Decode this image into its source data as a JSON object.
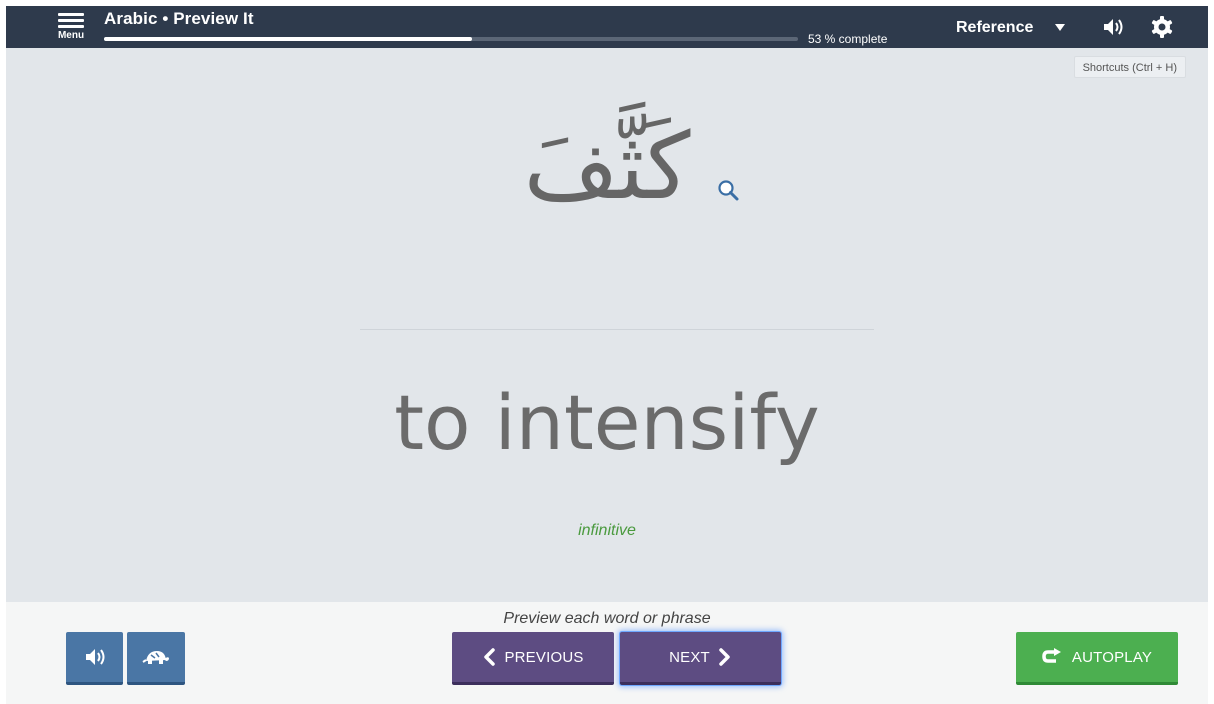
{
  "header": {
    "menu_label": "Menu",
    "course_title": "Arabic • Preview It",
    "progress_percent": 53,
    "progress_text": "53 % complete",
    "reference_label": "Reference"
  },
  "main": {
    "shortcuts_label": "Shortcuts (Ctrl + H)",
    "arabic_word": "كَثَّفَ",
    "meaning": "to intensify",
    "part_of_speech": "infinitive"
  },
  "footer": {
    "instruction": "Preview each word or phrase",
    "previous_label": "PREVIOUS",
    "next_label": "NEXT",
    "autoplay_label": "AUTOPLAY"
  },
  "colors": {
    "topbar": "#2e3a4c",
    "content_bg": "#e2e6ea",
    "audio_button": "#4a76a5",
    "nav_button": "#5d4c82",
    "autoplay_button": "#4caf50",
    "part_of_speech": "#4a9a3e"
  },
  "icons": [
    "hamburger-icon",
    "speaker-icon",
    "caret-down-icon",
    "gear-icon",
    "magnifier-icon",
    "turtle-icon",
    "chevron-left-icon",
    "chevron-right-icon",
    "repeat-arrow-icon"
  ]
}
